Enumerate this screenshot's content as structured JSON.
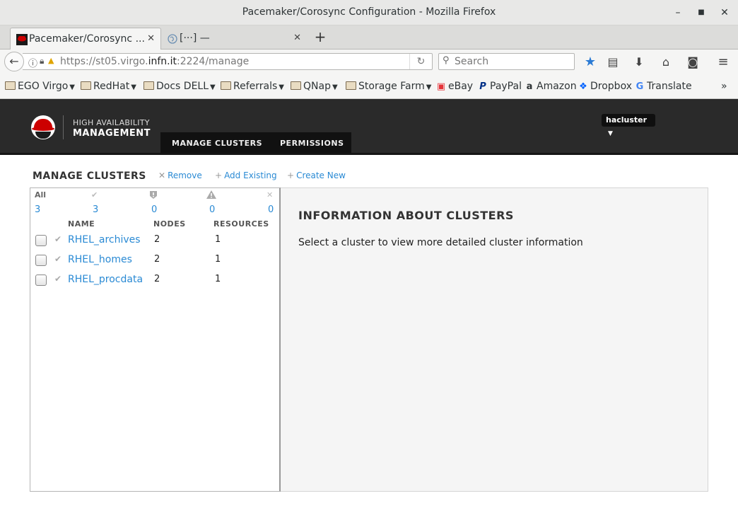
{
  "window": {
    "title": "Pacemaker/Corosync Configuration - Mozilla Firefox",
    "buttons": {
      "minimize": "–",
      "maximize": "■",
      "close": "✕"
    }
  },
  "tabs": [
    {
      "label": "Pacemaker/Corosync ...",
      "close": "✕",
      "favicon": "redhat-icon"
    },
    {
      "label": "[···] —",
      "close": "✕",
      "favicon": "globe-icon"
    }
  ],
  "newtab_label": "+",
  "nav": {
    "url_host_prefix": "https://st05.virgo.",
    "url_host_domain": "infn.it",
    "url_path": ":2224/manage",
    "search_placeholder": "Search"
  },
  "bookmarks": [
    {
      "label": "EGO Virgo",
      "type": "folder"
    },
    {
      "label": "RedHat",
      "type": "folder"
    },
    {
      "label": "Docs DELL",
      "type": "folder"
    },
    {
      "label": "Referrals",
      "type": "folder"
    },
    {
      "label": "QNap",
      "type": "folder"
    },
    {
      "label": "Storage Farm",
      "type": "folder"
    },
    {
      "label": "eBay",
      "type": "link",
      "icon": "ebay-icon"
    },
    {
      "label": "PayPal",
      "type": "link",
      "icon": "paypal-icon"
    },
    {
      "label": "Amazon",
      "type": "link",
      "icon": "amazon-icon"
    },
    {
      "label": "Dropbox",
      "type": "link",
      "icon": "dropbox-icon"
    },
    {
      "label": "Translate",
      "type": "link",
      "icon": "translate-icon"
    }
  ],
  "bookmarks_overflow": "»",
  "app": {
    "brand_line1": "HIGH AVAILABILITY",
    "brand_line2": "MANAGEMENT",
    "nav": [
      "MANAGE CLUSTERS",
      "PERMISSIONS"
    ],
    "user": "hacluster"
  },
  "page": {
    "title": "MANAGE CLUSTERS",
    "actions": [
      "Remove",
      "Add Existing",
      "Create New"
    ]
  },
  "summary": {
    "headers": [
      "All",
      "ok",
      "error",
      "warning",
      "unknown"
    ],
    "values": [
      "3",
      "3",
      "0",
      "0",
      "0"
    ]
  },
  "table": {
    "columns": [
      "NAME",
      "NODES",
      "RESOURCES"
    ],
    "rows": [
      {
        "name": "RHEL_archives",
        "nodes": "2",
        "resources": "1"
      },
      {
        "name": "RHEL_homes",
        "nodes": "2",
        "resources": "1"
      },
      {
        "name": "RHEL_procdata",
        "nodes": "2",
        "resources": "1"
      }
    ]
  },
  "info": {
    "heading": "INFORMATION ABOUT CLUSTERS",
    "text": "Select a cluster to view more detailed cluster information"
  }
}
